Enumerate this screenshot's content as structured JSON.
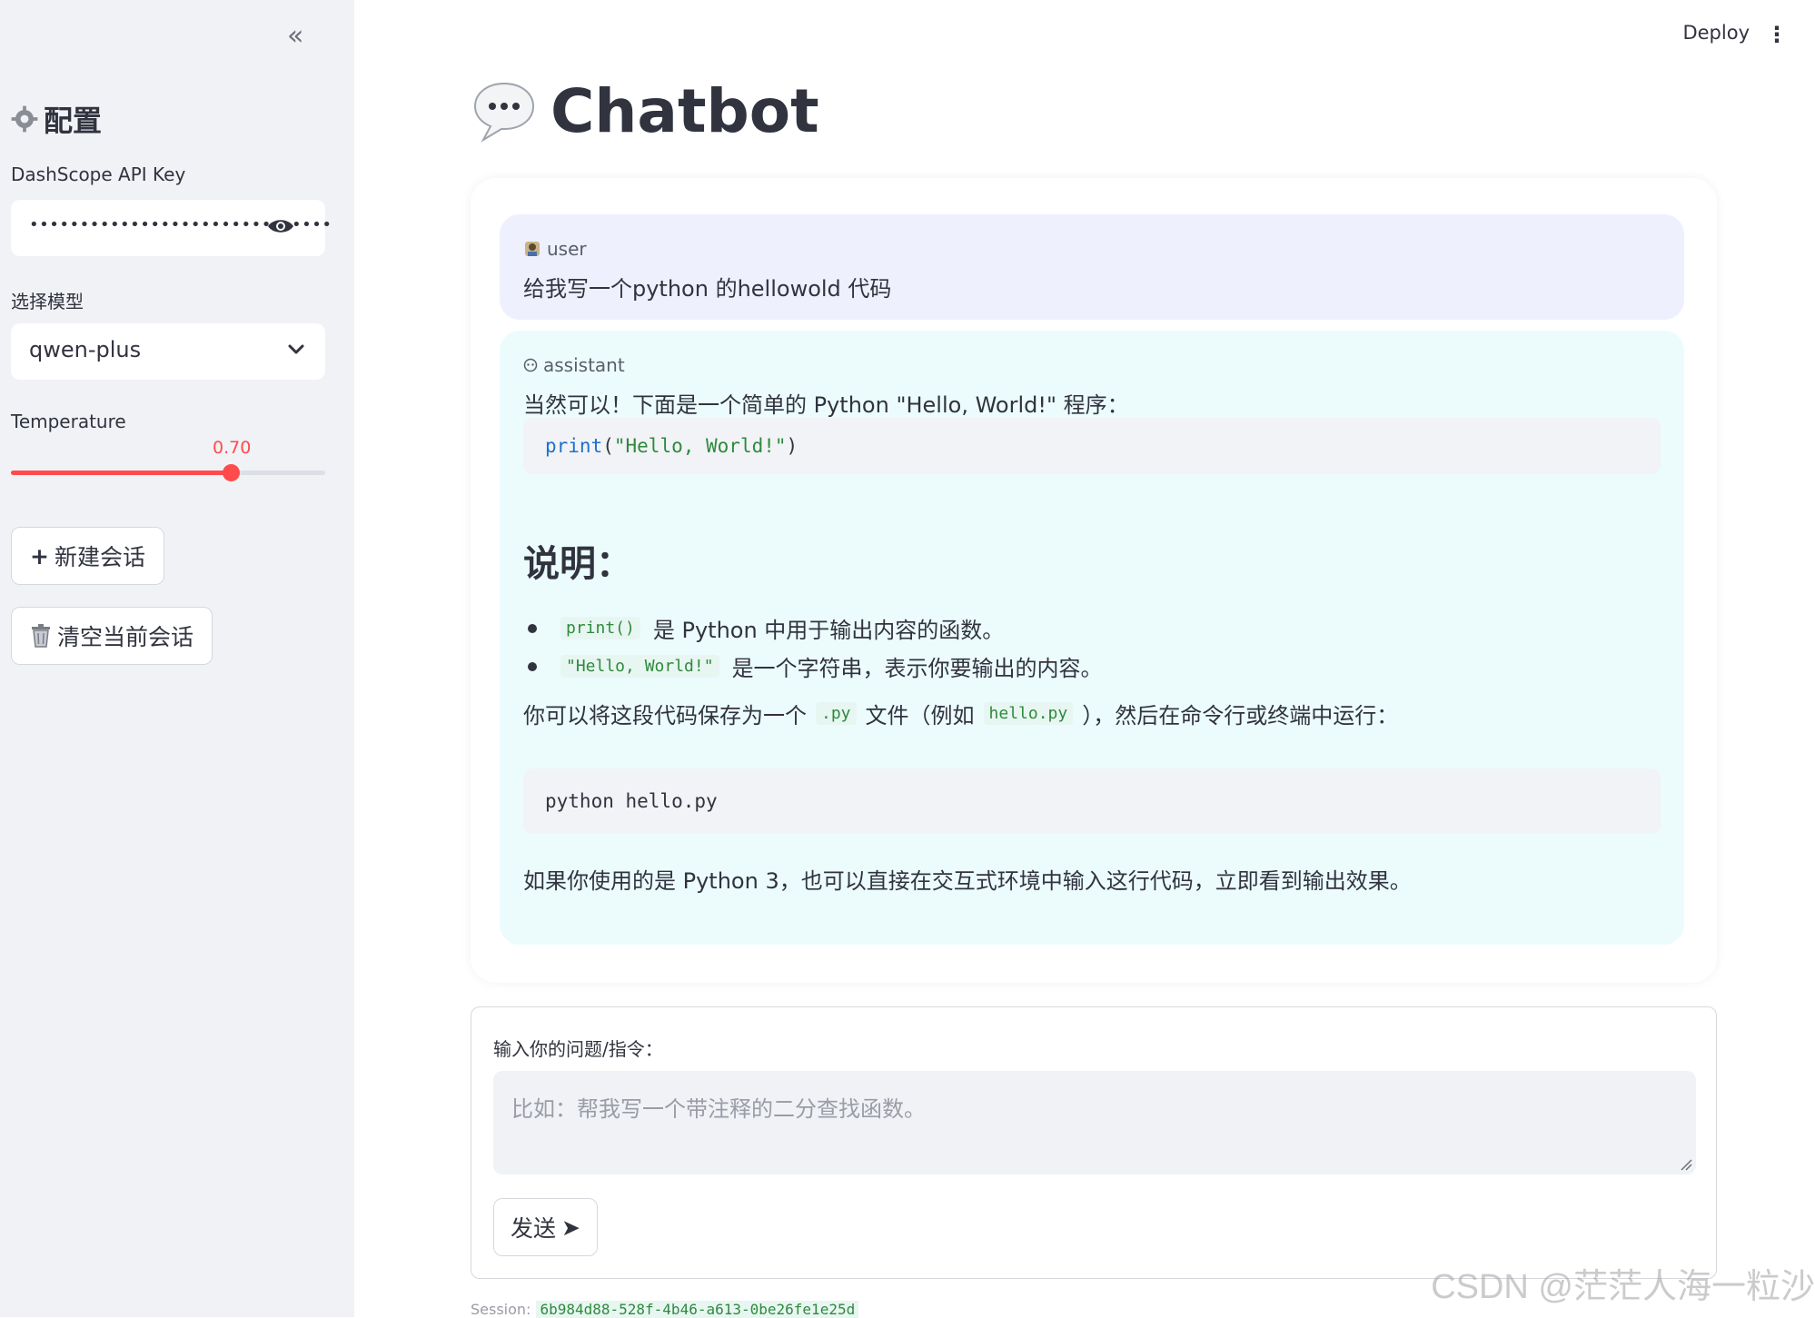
{
  "sidebar": {
    "collapse_icon": "«",
    "title": "配置",
    "title_icon": "gear-icon",
    "api_key_label": "DashScope API Key",
    "api_key_value": "••••••••••••••••••••••••••••••",
    "model_label": "选择模型",
    "model_value": "qwen-plus",
    "temperature_label": "Temperature",
    "temperature_value": "0.70",
    "temperature_fraction": 0.7,
    "new_chat_label": "新建会话",
    "new_chat_icon": "+",
    "clear_chat_label": "清空当前会话",
    "clear_chat_icon": "trash-icon"
  },
  "header": {
    "deploy_label": "Deploy",
    "menu_icon": "⋮"
  },
  "main": {
    "title": "Chatbot",
    "title_icon": "speech-bubble-icon"
  },
  "messages": {
    "user": {
      "role": "user",
      "icon": "user-avatar-icon",
      "text": "给我写一个python 的hellowold 代码"
    },
    "assistant": {
      "role": "assistant",
      "icon": "robot-icon",
      "intro": "当然可以！下面是一个简单的 Python \"Hello, World!\" 程序：",
      "code1_fn": "print",
      "code1_open": "(",
      "code1_str": "\"Hello, World!\"",
      "code1_close": ")",
      "heading": "说明：",
      "bullet1_code": "print()",
      "bullet1_text": "是 Python 中用于输出内容的函数。",
      "bullet2_code": "\"Hello, World!\"",
      "bullet2_text": "是一个字符串，表示你要输出的内容。",
      "para_a": "你可以将这段代码保存为一个",
      "para_code1": ".py",
      "para_b": "文件（例如",
      "para_code2": "hello.py",
      "para_c": "），然后在命令行或终端中运行：",
      "code2": "python hello.py",
      "outro": "如果你使用的是 Python 3，也可以直接在交互式环境中输入这行代码，立即看到输出效果。"
    }
  },
  "input": {
    "label": "输入你的问题/指令：",
    "placeholder": "比如：帮我写一个带注释的二分查找函数。",
    "send_label": "发送",
    "send_icon": "➤"
  },
  "footer": {
    "session_label": "Session:",
    "session_id": "6b984d88-528f-4b46-a613-0be26fe1e25d",
    "watermark": "CSDN @茫茫人海一粒沙"
  }
}
